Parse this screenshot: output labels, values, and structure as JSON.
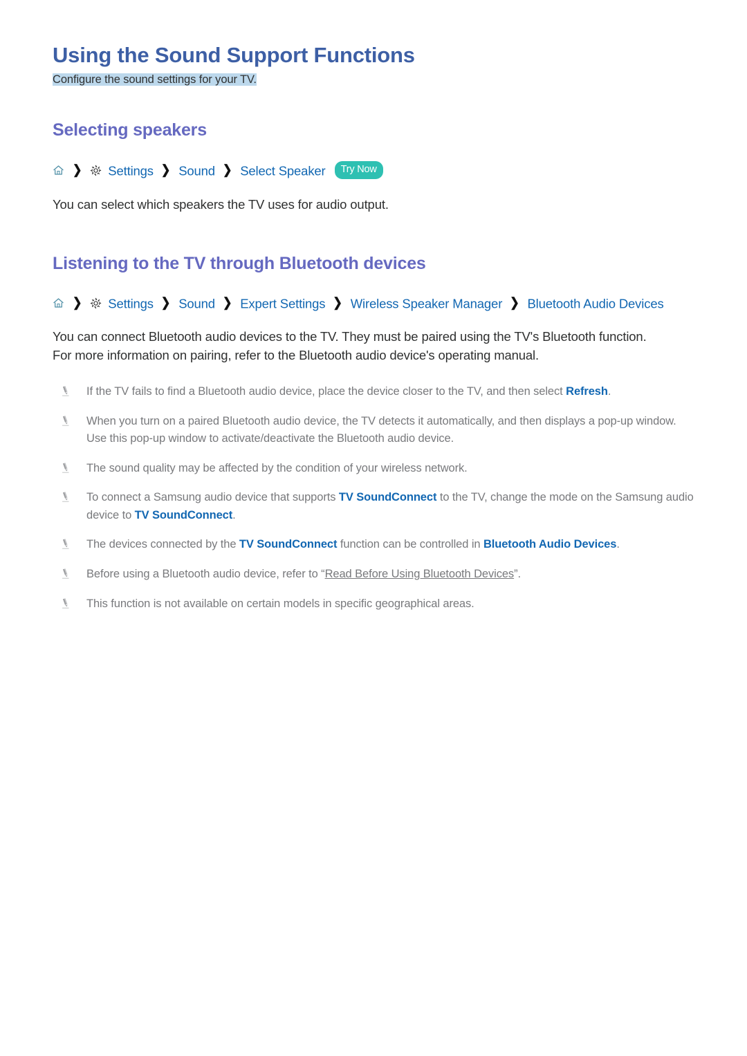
{
  "document": {
    "title": "Using the Sound Support Functions",
    "subtitle": "Configure the sound settings for your TV."
  },
  "colors": {
    "title": "#3d5fa5",
    "heading": "#6569c0",
    "link": "#1267b2",
    "body": "#2f3030",
    "note": "#78797c",
    "badge": "#2ec0b2",
    "highlight": "#bcd8ec"
  },
  "sections": [
    {
      "heading": "Selecting speakers",
      "breadcrumb": {
        "home_icon": "home-icon",
        "gear_icon": "gear-icon",
        "separator": "❯",
        "items": [
          "Settings",
          "Sound",
          "Select Speaker"
        ],
        "badge": "Try Now"
      },
      "body": "You can select which speakers the TV uses for audio output."
    },
    {
      "heading": "Listening to the TV through Bluetooth devices",
      "breadcrumb": {
        "home_icon": "home-icon",
        "gear_icon": "gear-icon",
        "separator": "❯",
        "items": [
          "Settings",
          "Sound",
          "Expert Settings",
          "Wireless Speaker Manager",
          "Bluetooth Audio Devices"
        ],
        "badge": ""
      },
      "body_line_1": "You can connect Bluetooth audio devices to the TV. They must be paired using the TV's Bluetooth function.",
      "body_line_2": "For more information on pairing, refer to the Bluetooth audio device's operating manual.",
      "notes": [
        {
          "icon": "pencil-icon",
          "parts": [
            {
              "t": "If the TV fails to find a Bluetooth audio device, place the device closer to the TV, and then select ",
              "s": "plain"
            },
            {
              "t": "Refresh",
              "s": "link"
            },
            {
              "t": ".",
              "s": "plain"
            }
          ]
        },
        {
          "icon": "pencil-icon",
          "parts": [
            {
              "t": "When you turn on a paired Bluetooth audio device, the TV detects it automatically, and then displays a pop-up window. Use this pop-up window to activate/deactivate the Bluetooth audio device.",
              "s": "plain"
            }
          ]
        },
        {
          "icon": "pencil-icon",
          "parts": [
            {
              "t": "The sound quality may be affected by the condition of your wireless network.",
              "s": "plain"
            }
          ]
        },
        {
          "icon": "pencil-icon",
          "parts": [
            {
              "t": "To connect a Samsung audio device that supports ",
              "s": "plain"
            },
            {
              "t": "TV SoundConnect",
              "s": "link"
            },
            {
              "t": " to the TV, change the mode on the Samsung audio device to ",
              "s": "plain"
            },
            {
              "t": "TV SoundConnect",
              "s": "link"
            },
            {
              "t": ".",
              "s": "plain"
            }
          ]
        },
        {
          "icon": "pencil-icon",
          "parts": [
            {
              "t": "The devices connected by the ",
              "s": "plain"
            },
            {
              "t": "TV SoundConnect",
              "s": "link"
            },
            {
              "t": " function can be controlled in ",
              "s": "plain"
            },
            {
              "t": "Bluetooth Audio Devices",
              "s": "link"
            },
            {
              "t": ".",
              "s": "plain"
            }
          ]
        },
        {
          "icon": "pencil-icon",
          "parts": [
            {
              "t": "Before using a Bluetooth audio device, refer to “",
              "s": "plain"
            },
            {
              "t": "Read Before Using Bluetooth Devices",
              "s": "underline"
            },
            {
              "t": "”.",
              "s": "plain"
            }
          ]
        },
        {
          "icon": "pencil-icon",
          "parts": [
            {
              "t": "This function is not available on certain models in specific geographical areas.",
              "s": "plain"
            }
          ]
        }
      ]
    }
  ]
}
